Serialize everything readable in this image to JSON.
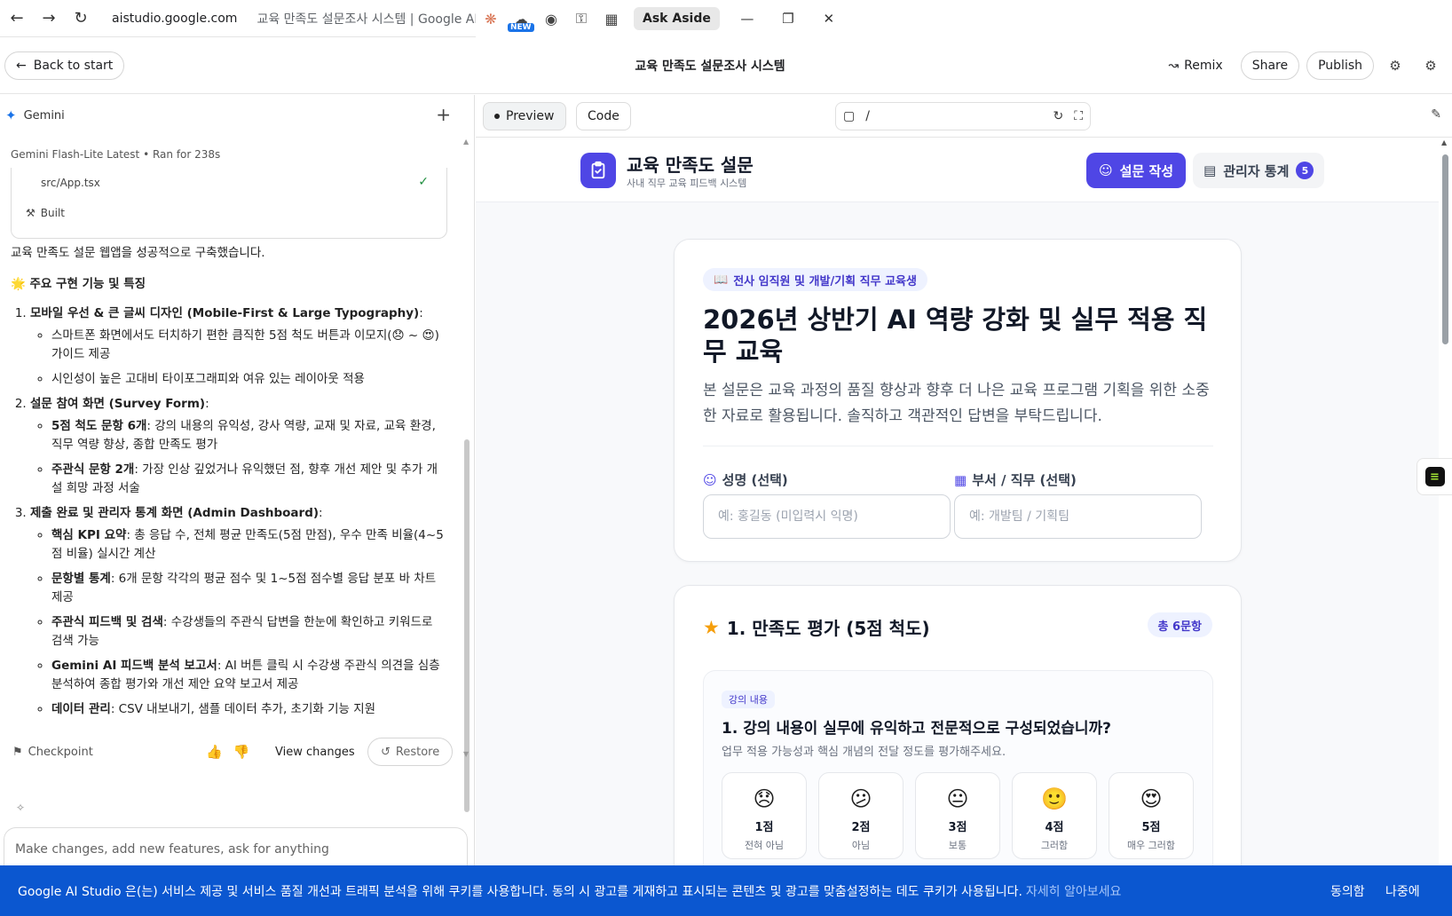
{
  "browser": {
    "url": "aistudio.google.com",
    "tab_title": "교육 만족도 설문조사 시스템 | Google AI Studio",
    "new_badge": "NEW",
    "ask_aside": "Ask Aside"
  },
  "header": {
    "back_label": "Back to start",
    "title": "교육 만족도 설문조사 시스템",
    "remix": "Remix",
    "share": "Share",
    "publish": "Publish"
  },
  "left_panel": {
    "assistant": "Gemini",
    "model": "Gemini Flash-Lite Latest",
    "ran_for": "Ran for 238s",
    "build_file": "src/App.tsx",
    "build_status": "Built",
    "intro": "교육 만족도 설문 웹앱을 성공적으로 구축했습니다.",
    "features_heading": "🌟 주요 구현 기능 및 특징",
    "sections": [
      {
        "title": "모바일 우선 & 큰 글씨 디자인 (Mobile-First & Large Typography)",
        "items": [
          {
            "bold": "",
            "text": "스마트폰 화면에서도 터치하기 편한 큼직한 5점 척도 버튼과 이모지(😞 ~ 😍) 가이드 제공"
          },
          {
            "bold": "",
            "text": "시인성이 높은 고대비 타이포그래피와 여유 있는 레이아웃 적용"
          }
        ]
      },
      {
        "title": "설문 참여 화면 (Survey Form)",
        "items": [
          {
            "bold": "5점 척도 문항 6개",
            "text": ": 강의 내용의 유익성, 강사 역량, 교재 및 자료, 교육 환경, 직무 역량 향상, 종합 만족도 평가"
          },
          {
            "bold": "주관식 문항 2개",
            "text": ": 가장 인상 깊었거나 유익했던 점, 향후 개선 제안 및 추가 개설 희망 과정 서술"
          }
        ]
      },
      {
        "title": "제출 완료 및 관리자 통계 화면 (Admin Dashboard)",
        "items": [
          {
            "bold": "핵심 KPI 요약",
            "text": ": 총 응답 수, 전체 평균 만족도(5점 만점), 우수 만족 비율(4~5점 비율) 실시간 계산"
          },
          {
            "bold": "문항별 통계",
            "text": ": 6개 문항 각각의 평균 점수 및 1~5점 점수별 응답 분포 바 차트 제공"
          },
          {
            "bold": "주관식 피드백 및 검색",
            "text": ": 수강생들의 주관식 답변을 한눈에 확인하고 키워드로 검색 가능"
          },
          {
            "bold": "Gemini AI 피드백 분석 보고서",
            "text": ": AI 버튼 클릭 시 수강생 주관식 의견을 심층 분석하여 종합 평가와 개선 제안 요약 보고서 제공"
          },
          {
            "bold": "데이터 관리",
            "text": ": CSV 내보내기, 샘플 데이터 추가, 초기화 기능 지원"
          }
        ]
      }
    ],
    "checkpoint": "Checkpoint",
    "view_changes": "View changes",
    "restore": "Restore",
    "input_placeholder": "Make changes, add new features, ask for anything"
  },
  "preview": {
    "tab_preview": "Preview",
    "tab_code": "Code",
    "path": "/",
    "brand_title": "교육 만족도 설문",
    "brand_sub": "사내 직무 교육 피드백 시스템",
    "nav_survey": "설문 작성",
    "nav_admin": "관리자 통계",
    "nav_admin_count": "5",
    "audience": "전사 임직원 및 개발/기획 직무 교육생",
    "survey_title": "2026년 상반기 AI 역량 강화 및 실무 적용 직무 교육",
    "survey_desc": "본 설문은 교육 과정의 품질 향상과 향후 더 나은 교육 프로그램 기획을 위한 소중한 자료로 활용됩니다. 솔직하고 객관적인 답변을 부탁드립니다.",
    "name_label": "성명 (선택)",
    "name_placeholder": "예: 홍길동 (미입력시 익명)",
    "dept_label": "부서 / 직무 (선택)",
    "dept_placeholder": "예: 개발팀 / 기획팀",
    "section_title": "1. 만족도 평가 (5점 척도)",
    "section_count": "총 6문항",
    "question": {
      "tag": "강의 내용",
      "text": "1. 강의 내용이 실무에 유익하고 전문적으로 구성되었습니까?",
      "help": "업무 적용 가능성과 핵심 개념의 전달 정도를 평가해주세요.",
      "options": [
        {
          "emoji": "😞",
          "score": "1점",
          "label": "전혀 아님"
        },
        {
          "emoji": "😕",
          "score": "2점",
          "label": "아님"
        },
        {
          "emoji": "😐",
          "score": "3점",
          "label": "보통"
        },
        {
          "emoji": "🙂",
          "score": "4점",
          "label": "그러함"
        },
        {
          "emoji": "😍",
          "score": "5점",
          "label": "매우 그러함"
        }
      ]
    }
  },
  "cookie": {
    "message": "Google AI Studio 은(는) 서비스 제공 및 서비스 품질 개선과 트래픽 분석을 위해 쿠키를 사용합니다. 동의 시 광고를 게재하고 표시되는 콘텐츠 및 광고를 맞춤설정하는 데도 쿠키가 사용됩니다.",
    "learn_more": "자세히 알아보세요",
    "agree": "동의함",
    "later": "나중에"
  },
  "colors": {
    "accent": "#4f46e5",
    "cookie_bg": "#0b57d0"
  }
}
